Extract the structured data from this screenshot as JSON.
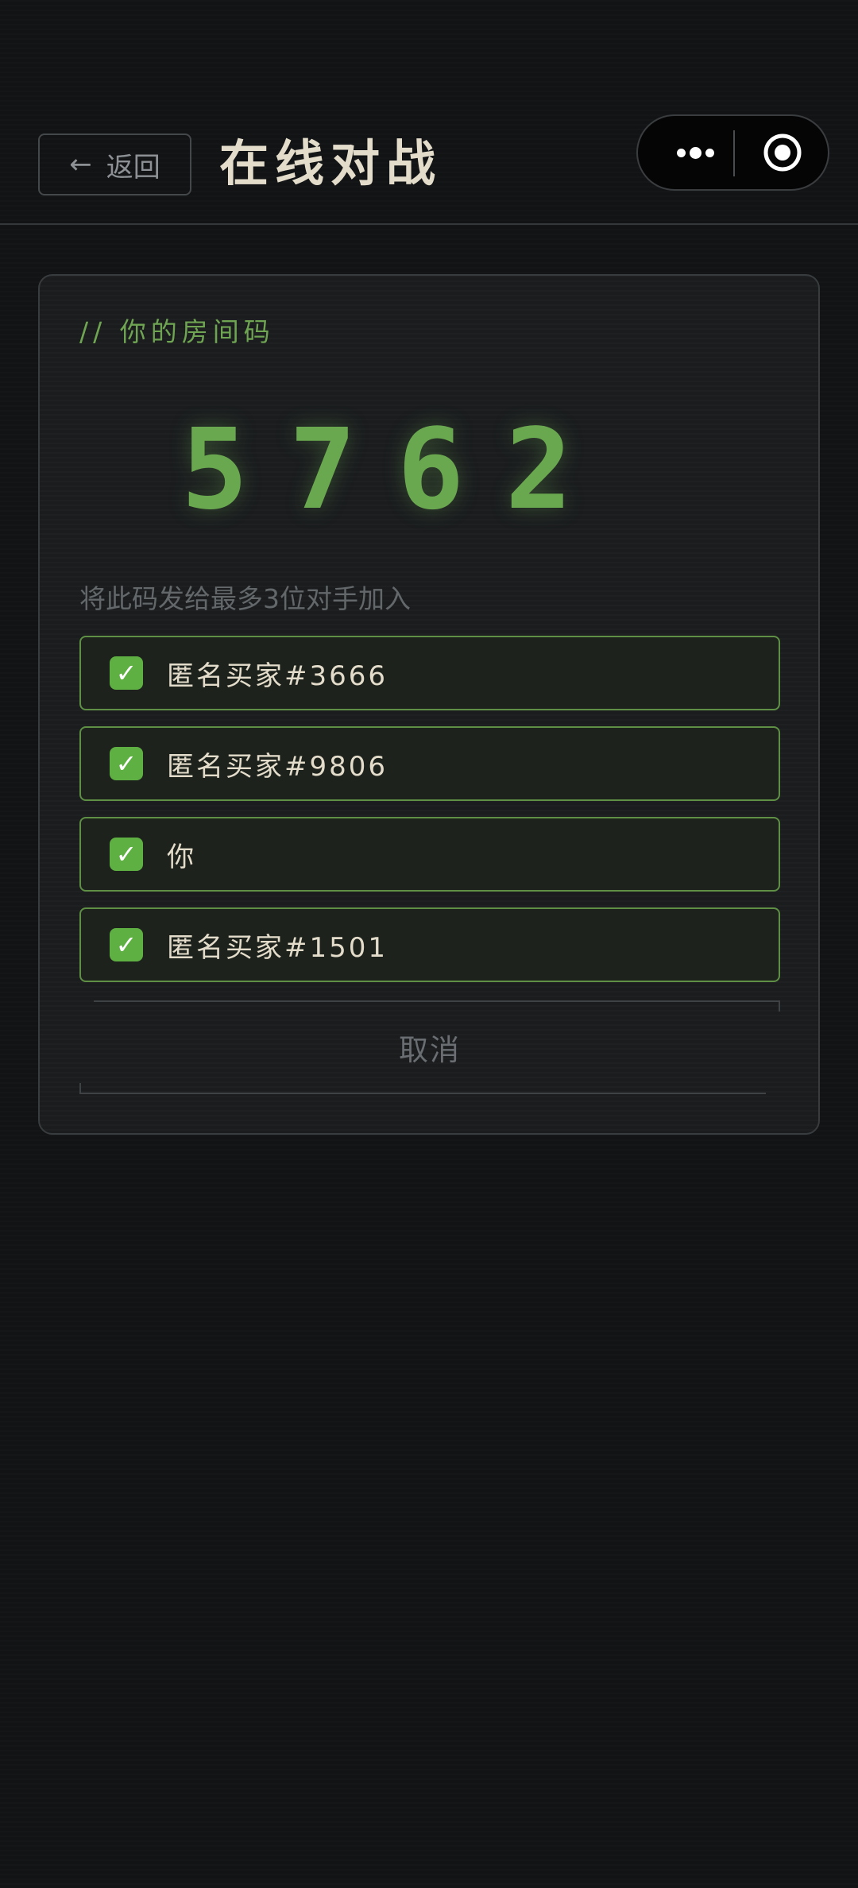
{
  "header": {
    "back_icon": "arrow-left-icon",
    "back_label": "返回",
    "title": "在线对战",
    "capsule": {
      "more_icon": "more-dots-icon",
      "close_icon": "target-circle-icon"
    }
  },
  "room": {
    "label": "//  你的房间码",
    "code_digits": [
      "5",
      "7",
      "6",
      "2"
    ],
    "hint": "将此码发给最多3位对手加入",
    "players": [
      {
        "status_icon": "check-mark-icon",
        "name": "匿名买家#3666"
      },
      {
        "status_icon": "check-mark-icon",
        "name": "匿名买家#9806"
      },
      {
        "status_icon": "check-mark-icon",
        "name": "你"
      },
      {
        "status_icon": "check-mark-icon",
        "name": "匿名买家#1501"
      }
    ],
    "cancel_label": "取消"
  },
  "colors": {
    "background": "#121314",
    "accent_green": "#6aa84f",
    "title_text": "#e4dccb",
    "check_green": "#5fb043"
  }
}
